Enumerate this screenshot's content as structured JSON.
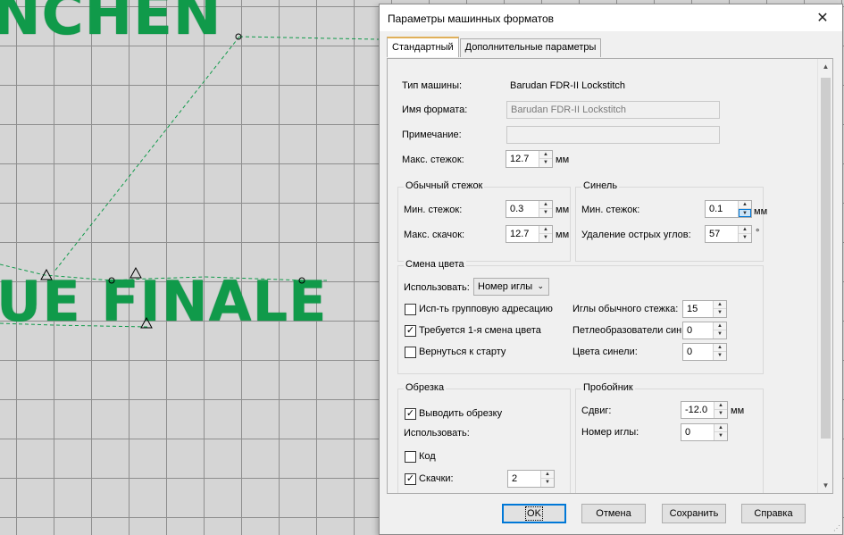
{
  "canvas": {
    "text_top": "NCHEN",
    "text_bottom": "UE FINALE"
  },
  "dialog": {
    "title": "Параметры машинных форматов",
    "close_glyph": "✕",
    "tabs": [
      {
        "label": "Стандартный"
      },
      {
        "label": "Дополнительные параметры"
      }
    ]
  },
  "general": {
    "machine_type_label": "Тип машины:",
    "machine_type_value": "Barudan FDR-II Lockstitch",
    "format_name_label": "Имя формата:",
    "format_name_value": "Barudan FDR-II Lockstitch",
    "note_label": "Примечание:",
    "note_value": "",
    "max_stitch_label": "Макс. стежок:",
    "max_stitch_value": "12.7",
    "unit_mm": "мм"
  },
  "normal_stitch": {
    "title": "Обычный стежок",
    "min_stitch_label": "Мин. стежок:",
    "min_stitch_value": "0.3",
    "max_jump_label": "Макс. скачок:",
    "max_jump_value": "12.7"
  },
  "chenille": {
    "title": "Синель",
    "min_stitch_label": "Мин. стежок:",
    "min_stitch_value": "0.1",
    "sharp_corners_label": "Удаление острых углов:",
    "sharp_corners_value": "57",
    "degree_unit": "°"
  },
  "color_change": {
    "title": "Смена цвета",
    "use_label": "Использовать:",
    "use_value": "Номер иглы",
    "group_addressing_label": "Исп-ть групповую адресацию",
    "group_addressing_checked": false,
    "first_change_label": "Требуется 1-я смена цвета",
    "first_change_checked": true,
    "return_start_label": "Вернуться к старту",
    "return_start_checked": false,
    "needles_normal_label": "Иглы обычного стежка:",
    "needles_normal_value": "15",
    "loopers_label": "Петлеобразователи син",
    "loopers_value": "0",
    "chenille_colors_label": "Цвета синели:",
    "chenille_colors_value": "0"
  },
  "trim": {
    "title": "Обрезка",
    "output_trim_label": "Выводить обрезку",
    "output_trim_checked": true,
    "use_label": "Использовать:",
    "code_label": "Код",
    "code_checked": false,
    "jumps_label": "Скачки:",
    "jumps_checked": true,
    "jumps_value": "2"
  },
  "punch": {
    "title": "Пробойник",
    "shift_label": "Сдвиг:",
    "shift_value": "-12.0",
    "needle_number_label": "Номер иглы:",
    "needle_number_value": "0"
  },
  "buttons": {
    "ok": "OK",
    "cancel": "Отмена",
    "save": "Сохранить",
    "help": "Справка"
  },
  "check_glyph": "✓"
}
